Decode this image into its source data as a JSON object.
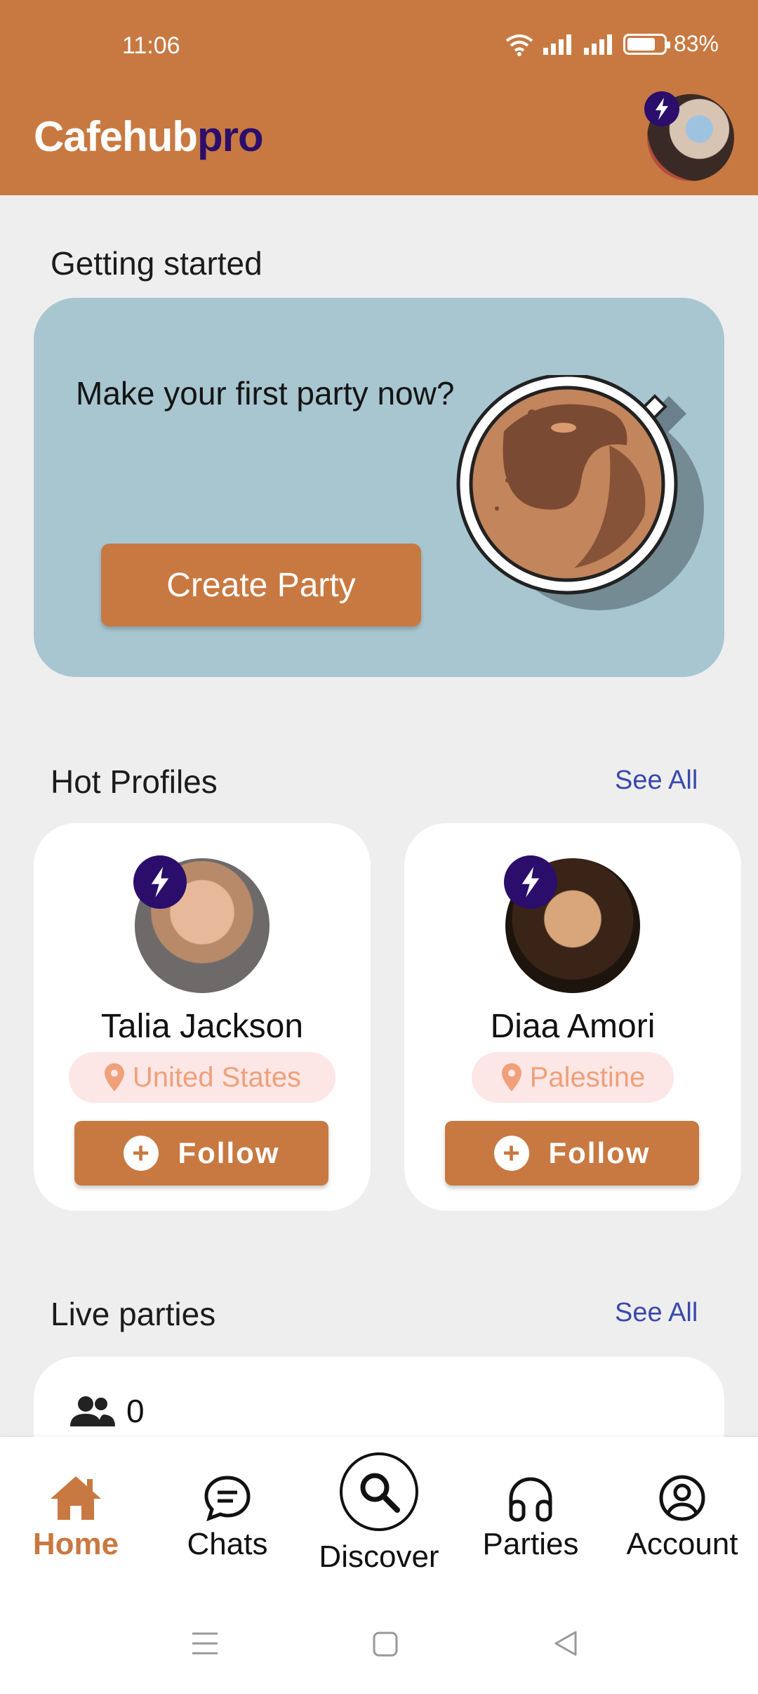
{
  "status_bar": {
    "time": "11:06",
    "battery": "83%"
  },
  "header": {
    "brand_part1": "Cafehub",
    "brand_part2": "pro"
  },
  "getting_started": {
    "title": "Getting started",
    "prompt": "Make your first party now?",
    "button_label": "Create Party"
  },
  "hot_profiles": {
    "title": "Hot Profiles",
    "see_all": "See All",
    "profiles": [
      {
        "name": "Talia Jackson",
        "location": "United States",
        "follow_label": "Follow"
      },
      {
        "name": "Diaa Amori",
        "location": "Palestine",
        "follow_label": "Follow"
      }
    ]
  },
  "live_parties": {
    "title": "Live parties",
    "see_all": "See All",
    "participant_count": "0"
  },
  "bottom_nav": {
    "items": [
      {
        "label": "Home",
        "icon": "home-icon",
        "active": true
      },
      {
        "label": "Chats",
        "icon": "chat-icon"
      },
      {
        "label": "Discover",
        "icon": "search-icon"
      },
      {
        "label": "Parties",
        "icon": "headphones-icon"
      },
      {
        "label": "Account",
        "icon": "account-icon"
      }
    ]
  },
  "colors": {
    "primary": "#c87941",
    "brand_dark": "#2b0e6b",
    "hero_bg": "#a8c6d0",
    "link": "#3949ab",
    "pill_bg": "#fce7e6",
    "pill_text": "#f0a07a"
  }
}
